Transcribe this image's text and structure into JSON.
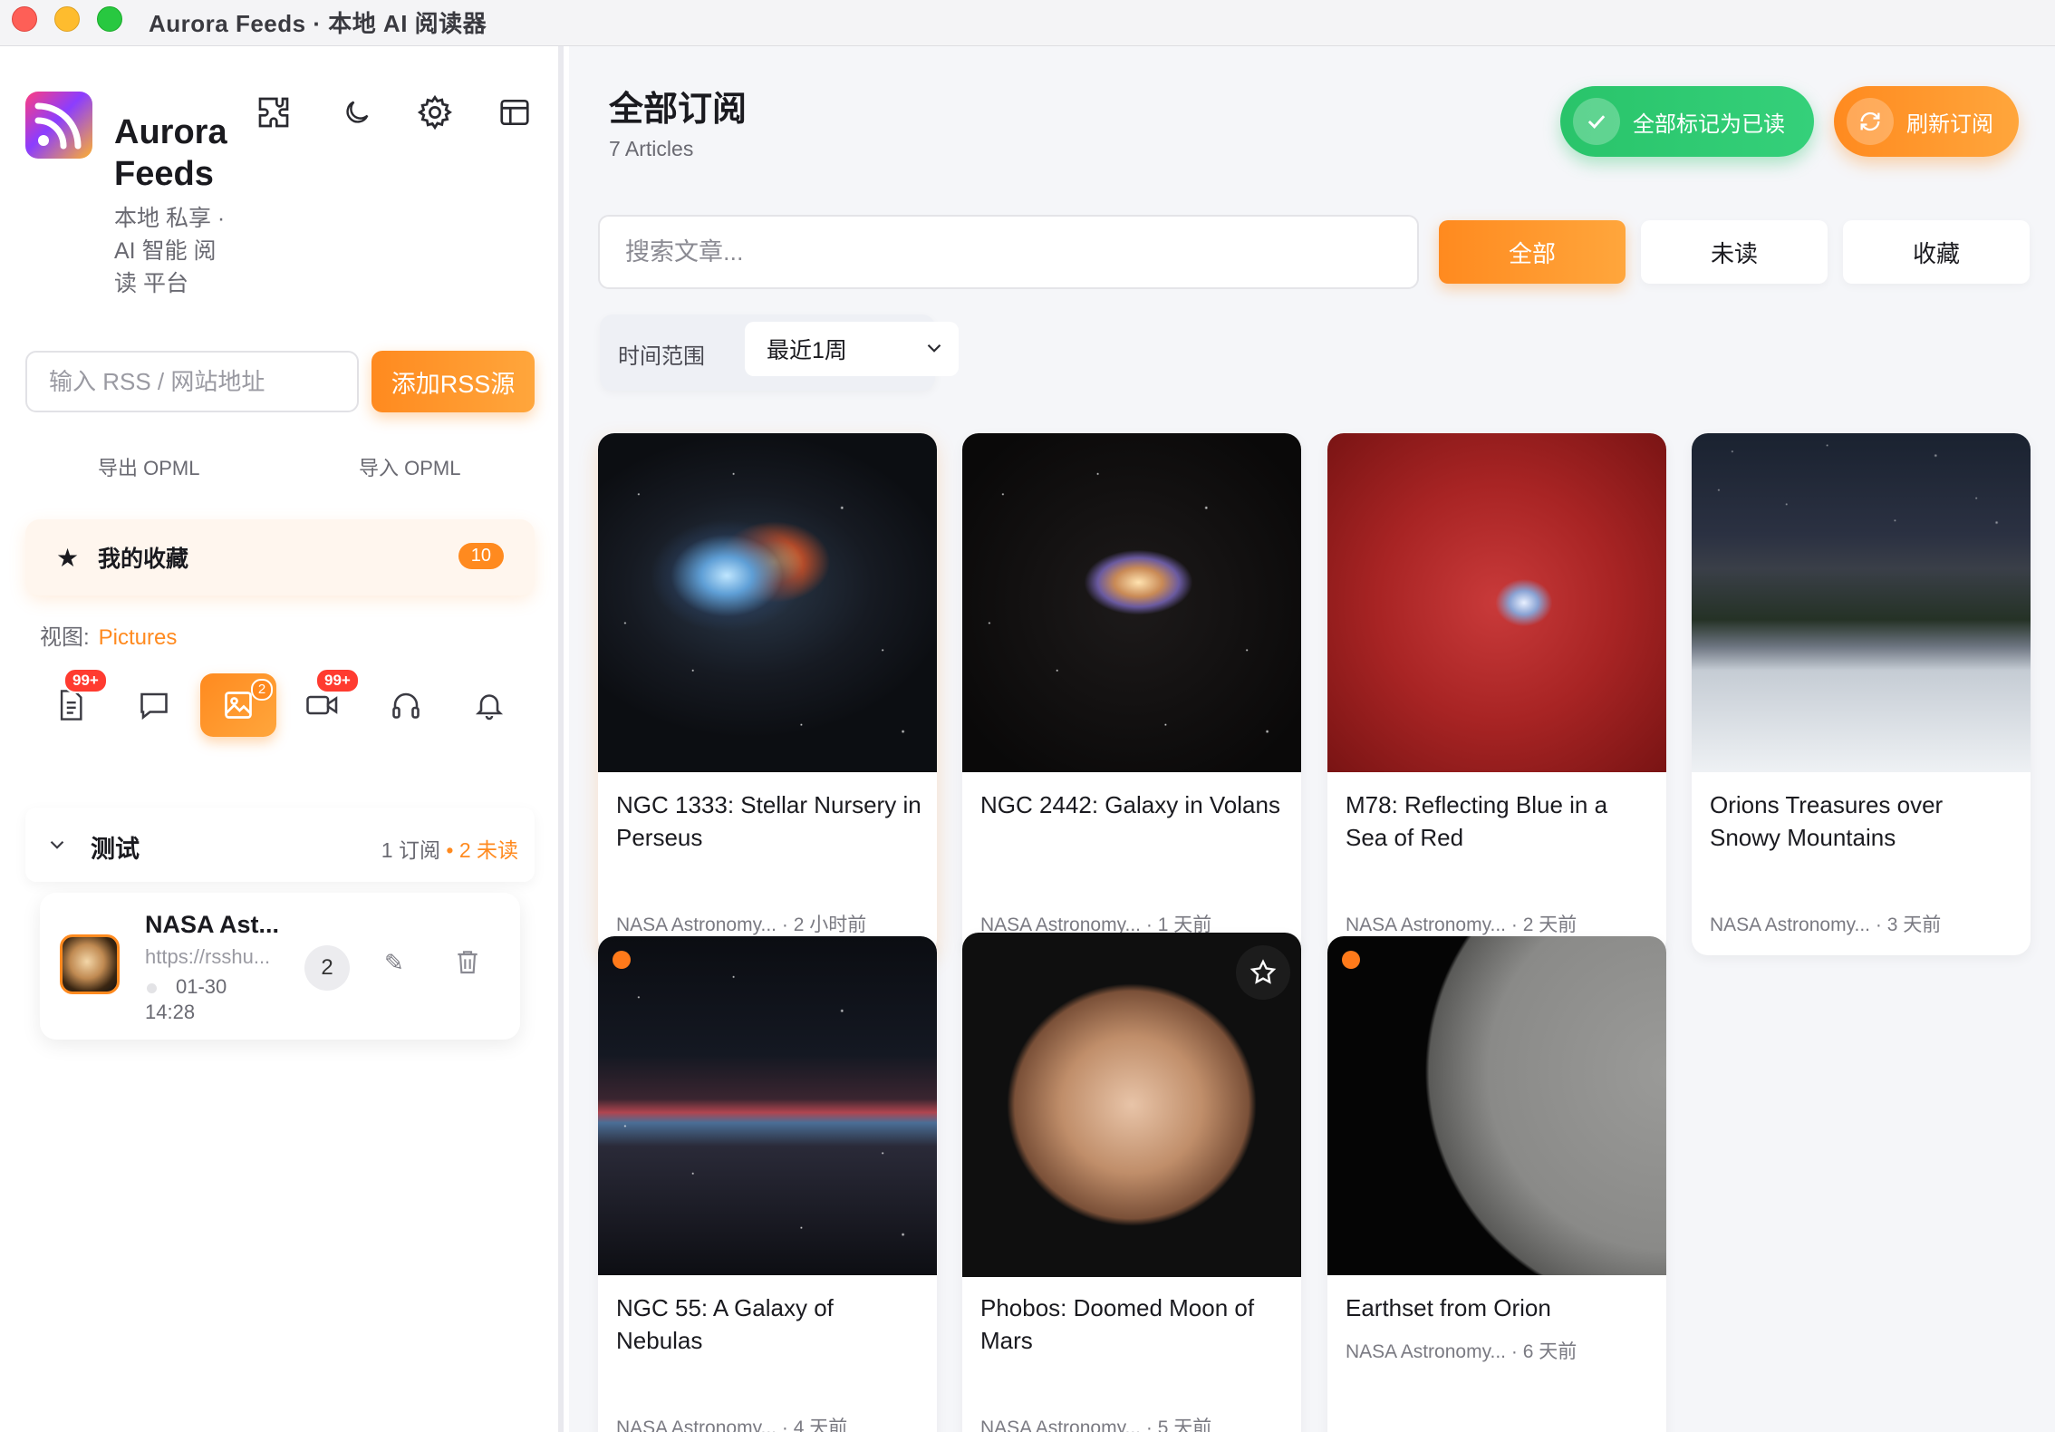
{
  "window": {
    "title": "Aurora Feeds · 本地 AI 阅读器"
  },
  "sidebar": {
    "brand": {
      "name": "Aurora Feeds",
      "tagline": "本地 私享 · AI 智能 阅读 平台"
    },
    "rss_input": {
      "placeholder": "输入 RSS / 网站地址",
      "value": ""
    },
    "add_button": "添加RSS源",
    "export_opml": "导出 OPML",
    "import_opml": "导入 OPML",
    "favorites": {
      "label": "我的收藏",
      "count": "10"
    },
    "view": {
      "label": "视图:",
      "value": "Pictures"
    },
    "categories": [
      {
        "name": "articles",
        "icon": "document-icon",
        "badge": "99+"
      },
      {
        "name": "social",
        "icon": "chat-bubble-icon",
        "badge": ""
      },
      {
        "name": "pictures",
        "icon": "image-icon",
        "badge": "2",
        "active": true
      },
      {
        "name": "videos",
        "icon": "video-icon",
        "badge": "99+"
      },
      {
        "name": "audio",
        "icon": "headphones-icon",
        "badge": ""
      },
      {
        "name": "notifications",
        "icon": "bell-icon",
        "badge": ""
      }
    ],
    "group": {
      "name": "测试",
      "subs": "1 订阅",
      "unread": "• 2 未读"
    },
    "feed": {
      "title": "NASA Ast...",
      "url": "https://rsshu...",
      "date": "01-30 14:28",
      "count": "2"
    }
  },
  "main": {
    "title": "全部订阅",
    "subtitle": "7 Articles",
    "mark_all_read": "全部标记为已读",
    "refresh": "刷新订阅",
    "search_placeholder": "搜索文章...",
    "filters": {
      "all": "全部",
      "unread": "未读",
      "starred": "收藏"
    },
    "time_range": {
      "label": "时间范围",
      "value": "最近1周"
    },
    "articles": [
      {
        "title": "NGC 1333: Stellar Nursery in Perseus",
        "source": "NASA Astronomy...",
        "time": "2 小时前",
        "unread": false
      },
      {
        "title": "NGC 2442: Galaxy in Volans",
        "source": "NASA Astronomy...",
        "time": "1 天前",
        "unread": false
      },
      {
        "title": "M78: Reflecting Blue in a Sea of Red",
        "source": "NASA Astronomy...",
        "time": "2 天前",
        "unread": false
      },
      {
        "title": "Orions Treasures over Snowy Mountains",
        "source": "NASA Astronomy...",
        "time": "3 天前",
        "unread": false
      },
      {
        "title": "NGC 55: A Galaxy of Nebulas",
        "source": "NASA Astronomy...",
        "time": "4 天前",
        "unread": true
      },
      {
        "title": "Phobos: Doomed Moon of Mars",
        "source": "NASA Astronomy...",
        "time": "5 天前",
        "unread": false
      },
      {
        "title": "Earthset from Orion",
        "source": "NASA Astronomy...",
        "time": "6 天前",
        "unread": true
      }
    ]
  },
  "colors": {
    "accent": "#ff8a1f",
    "success": "#29c46a",
    "badge": "#ff3b30"
  }
}
